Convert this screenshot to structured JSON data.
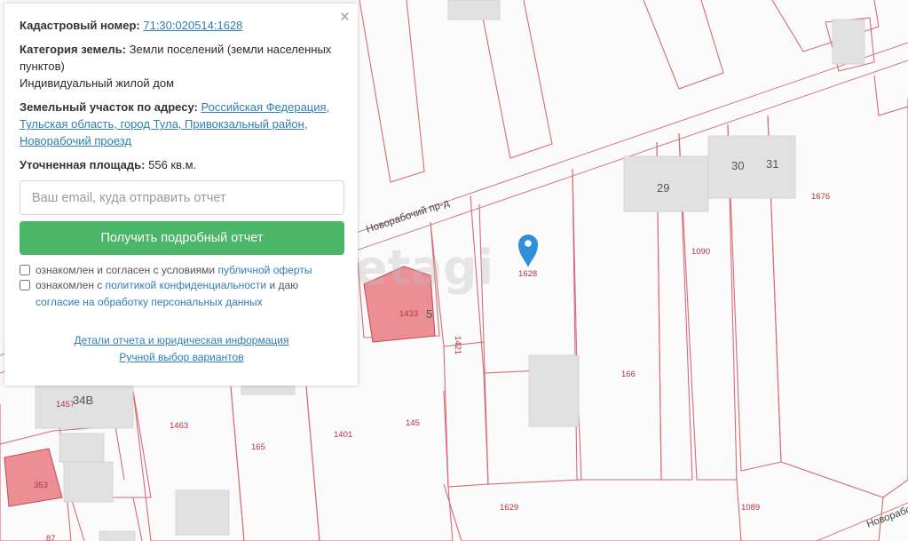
{
  "popup": {
    "close_symbol": "×",
    "cadastral_label": "Кадастровый номер:",
    "cadastral_number": "71:30:020514:1628",
    "land_category_label": "Категория земель:",
    "land_category_value": "Земли поселений (земли населенных пунктов)",
    "use_type": "Индивидуальный жилой дом",
    "address_label": "Земельный участок по адресу:",
    "address_value": "Российская Федерация, Тульская область, город Тула, Привокзальный район, Новорабочий проезд",
    "area_label": "Уточненная площадь:",
    "area_value": "556 кв.м.",
    "email_placeholder": "Ваш email, куда отправить отчет",
    "submit_label": "Получить подробный отчет",
    "consent1_text": "ознакомлен и согласен с условиями",
    "consent1_link": "публичной оферты",
    "consent2_text": "ознакомлен с",
    "consent2_link1": "политикой конфиденциальности",
    "consent2_mid": "и даю",
    "consent2_link2": "согласие на обработку персональных данных",
    "details_link": "Детали отчета и юридическая информация",
    "manual_link": "Ручной выбор вариантов"
  },
  "map": {
    "parcel_labels": [
      "1628",
      "166",
      "1090",
      "1676",
      "1433",
      "1421",
      "145",
      "1401",
      "165",
      "1463",
      "1457",
      "1629",
      "1089",
      "353",
      "87"
    ],
    "building_numbers": [
      "29",
      "30",
      "31",
      "34В",
      "5"
    ],
    "road_labels": [
      "Новорабочий пр-д",
      "Новорабочий"
    ],
    "watermark": "etagi",
    "marker_icon": "map-pin-icon",
    "colors": {
      "parcel_stroke": "#d86a74",
      "highlight_parcel": "#ec8f95",
      "building": "#e1e1e1",
      "marker": "#2f8fd8",
      "button": "#4cb668",
      "link": "#2f7fb4"
    }
  }
}
